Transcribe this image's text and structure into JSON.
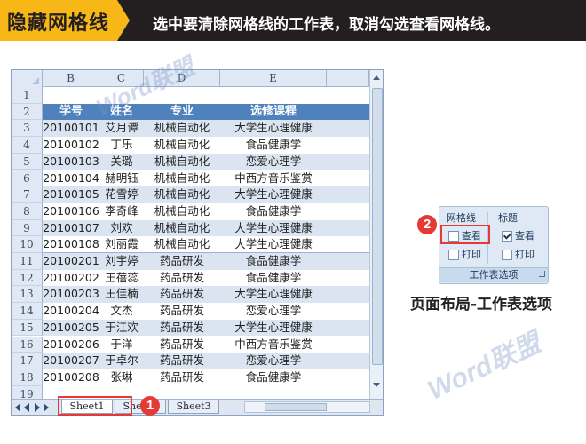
{
  "banner": {
    "tag": "隐藏网格线",
    "text": "选中要清除网格线的工作表，取消勾选查看网格线。"
  },
  "sheet": {
    "columns": [
      "B",
      "C",
      "D",
      "E"
    ],
    "row_numbers": [
      "1",
      "2",
      "3",
      "4",
      "5",
      "6",
      "7",
      "8",
      "9",
      "10",
      "11",
      "12",
      "13",
      "14",
      "15",
      "16",
      "17",
      "18",
      "19"
    ],
    "header": [
      "学号",
      "姓名",
      "专业",
      "选修课程"
    ],
    "rows": [
      [
        "20100101",
        "艾月谭",
        "机械自动化",
        "大学生心理健康"
      ],
      [
        "20100102",
        "丁乐",
        "机械自动化",
        "食品健康学"
      ],
      [
        "20100103",
        "关璐",
        "机械自动化",
        "恋爱心理学"
      ],
      [
        "20100104",
        "赫明钰",
        "机械自动化",
        "中西方音乐鉴赏"
      ],
      [
        "20100105",
        "花雪婷",
        "机械自动化",
        "大学生心理健康"
      ],
      [
        "20100106",
        "李奇峰",
        "机械自动化",
        "食品健康学"
      ],
      [
        "20100107",
        "刘欢",
        "机械自动化",
        "大学生心理健康"
      ],
      [
        "20100108",
        "刘丽霞",
        "机械自动化",
        "大学生心理健康"
      ],
      [
        "20100201",
        "刘宇婷",
        "药品研发",
        "食品健康学"
      ],
      [
        "20100202",
        "王蓓蕊",
        "药品研发",
        "食品健康学"
      ],
      [
        "20100203",
        "王佳楠",
        "药品研发",
        "大学生心理健康"
      ],
      [
        "20100204",
        "文杰",
        "药品研发",
        "恋爱心理学"
      ],
      [
        "20100205",
        "于江欢",
        "药品研发",
        "大学生心理健康"
      ],
      [
        "20100206",
        "于洋",
        "药品研发",
        "中西方音乐鉴赏"
      ],
      [
        "20100207",
        "于卓尔",
        "药品研发",
        "恋爱心理学"
      ],
      [
        "20100208",
        "张琳",
        "药品研发",
        "食品健康学"
      ]
    ],
    "tabs": [
      "Sheet1",
      "Sheet2",
      "Sheet3"
    ],
    "active_tab": "Sheet1"
  },
  "annotations": {
    "badge1": "1",
    "badge2": "2"
  },
  "ribbon": {
    "gridlines_title": "网格线",
    "headings_title": "标题",
    "view_label": "查看",
    "print_label": "打印",
    "gridlines_view_checked": false,
    "gridlines_print_checked": false,
    "headings_view_checked": true,
    "headings_print_checked": false,
    "group_label": "工作表选项"
  },
  "caption": "页面布局-工作表选项",
  "watermark": {
    "brand_word": "Word",
    "brand_cn": "联盟"
  },
  "colors": {
    "banner_bg": "#231f20",
    "tag_bg": "#f6b717",
    "header_row": "#4f81bd",
    "band_row": "#dbe5f1",
    "annotation_red": "#e53935"
  }
}
